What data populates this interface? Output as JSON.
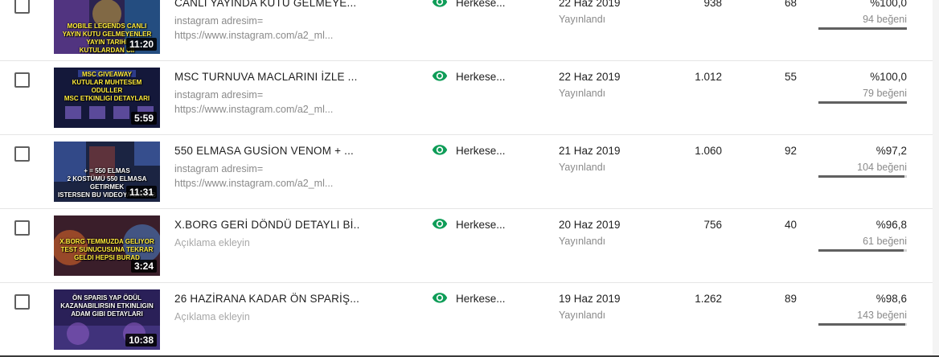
{
  "videos": [
    {
      "title": "CANLI YAYINDA KUTU GELMEYE...",
      "description": "instagram adresim=\nhttps://www.instagram.com/a2_ml...",
      "description_placeholder": false,
      "thumbnail_text": "MOBILE LEGENDS CANLI\nYAYIN KUTU GELMEYENLER\nYAYIN TARIHI\nKUTULARDAN CII",
      "duration": "11:20",
      "visibility": "Herkese...",
      "visibility_icon": "eye-icon",
      "date": "22 Haz 2019",
      "date_status": "Yayınlandı",
      "views": "938",
      "comments": "68",
      "like_percent_label": "%100,0",
      "like_percent": 100.0,
      "likes_label": "94 beğeni"
    },
    {
      "title": "MSC TURNUVA MACLARINI İZLE ...",
      "description": "instagram adresim=\nhttps://www.instagram.com/a2_ml...",
      "description_placeholder": false,
      "thumbnail_text": "MSC GIVEAWAY\nKUTULAR MUHTESEM ODULLER\nMSC ETKINLIGI DETAYLARI",
      "duration": "5:59",
      "visibility": "Herkese...",
      "visibility_icon": "eye-icon",
      "date": "22 Haz 2019",
      "date_status": "Yayınlandı",
      "views": "1.012",
      "comments": "55",
      "like_percent_label": "%100,0",
      "like_percent": 100.0,
      "likes_label": "79 beğeni"
    },
    {
      "title": "550 ELMASA GUSİON VENOM + ...",
      "description": "instagram adresim=\nhttps://www.instagram.com/a2_ml...",
      "description_placeholder": false,
      "thumbnail_text": "+   = 550 ELMAS\n2 KOSTÜMÜ 550 ELMASA GETIRMEK\nISTERSEN BU VIDEOYA BAKAB",
      "duration": "11:31",
      "visibility": "Herkese...",
      "visibility_icon": "eye-icon",
      "date": "21 Haz 2019",
      "date_status": "Yayınlandı",
      "views": "1.060",
      "comments": "92",
      "like_percent_label": "%97,2",
      "like_percent": 97.2,
      "likes_label": "104 beğeni"
    },
    {
      "title": "X.BORG GERİ DÖNDÜ DETAYLI Bİ...",
      "description": "Açıklama ekleyin",
      "description_placeholder": true,
      "thumbnail_text": "X.BORG TEMMUZDA GELIYOR\nTEST SUNUCUSUNA TEKRAR\nGELDI HEPSI BURAD",
      "duration": "3:24",
      "visibility": "Herkese...",
      "visibility_icon": "eye-icon",
      "date": "20 Haz 2019",
      "date_status": "Yayınlandı",
      "views": "756",
      "comments": "40",
      "like_percent_label": "%96,8",
      "like_percent": 96.8,
      "likes_label": "61 beğeni"
    },
    {
      "title": "26 HAZİRANA KADAR ÖN SPARİŞ...",
      "description": "Açıklama ekleyin",
      "description_placeholder": true,
      "thumbnail_text": "ÖN SPARIS YAP ÖDÜL\nKAZANABILIRSIN ETKINLIGIN\nADAM GIBI DETAYLARI",
      "duration": "10:38",
      "visibility": "Herkese...",
      "visibility_icon": "eye-icon",
      "date": "19 Haz 2019",
      "date_status": "Yayınlandı",
      "views": "1.262",
      "comments": "89",
      "like_percent_label": "%98,6",
      "like_percent": 98.6,
      "likes_label": "143 beğeni"
    }
  ],
  "colors": {
    "visibility_icon": "#0f9d58",
    "bar_fill": "#606060",
    "bar_track": "#d5d5d5"
  }
}
